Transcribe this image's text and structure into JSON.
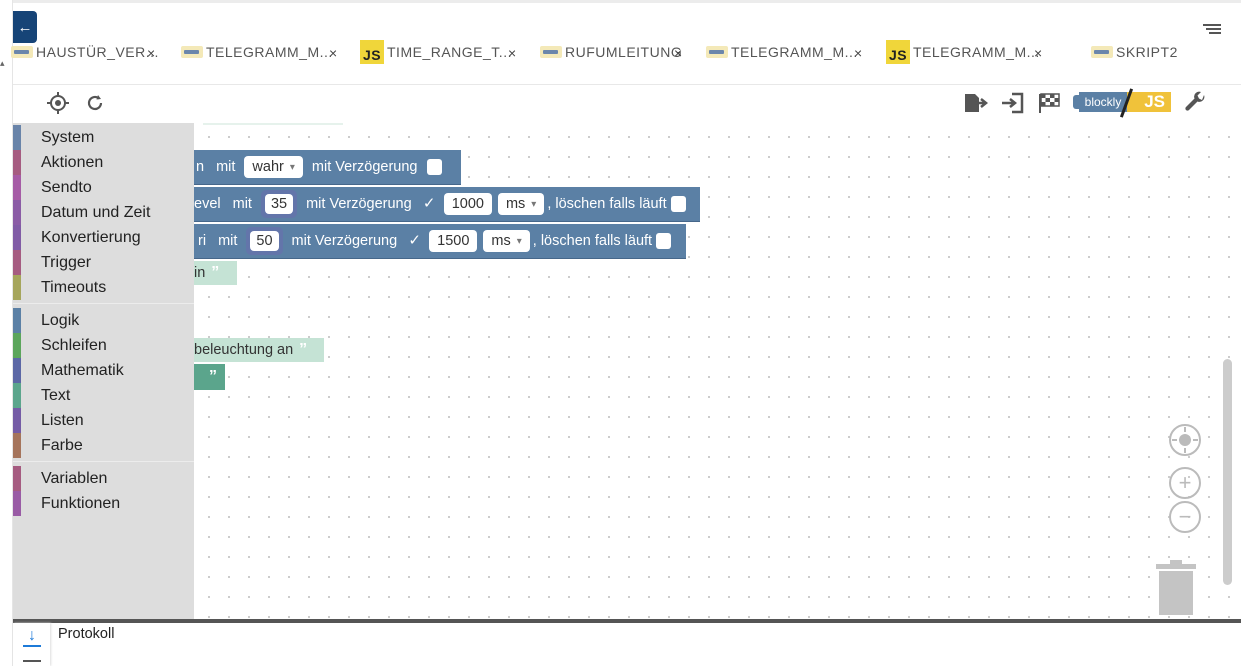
{
  "tabs": [
    {
      "icon": "blockly-icon",
      "label": "HAUSTÜR_VER...",
      "close": "×"
    },
    {
      "icon": "blockly-icon",
      "label": "TELEGRAMM_M...",
      "close": "×"
    },
    {
      "icon": "js-icon",
      "icon_text": "JS",
      "label": "TIME_RANGE_T...",
      "close": "×"
    },
    {
      "icon": "blockly-icon",
      "label": "RUFUMLEITUNG",
      "close": "×"
    },
    {
      "icon": "blockly-icon",
      "label": "TELEGRAMM_M...",
      "close": "×"
    },
    {
      "icon": "js-icon",
      "icon_text": "JS",
      "label": "TELEGRAMM_M...",
      "close": "×"
    },
    {
      "icon": "blockly-icon",
      "label": "SKRIPT2",
      "close": ""
    }
  ],
  "toolbar": {
    "mode_blockly": "blockly",
    "mode_js": "JS"
  },
  "toolbox": {
    "categories": [
      {
        "label": "System",
        "color": "#6984a9"
      },
      {
        "label": "Aktionen",
        "color": "#a55b80"
      },
      {
        "label": "Sendto",
        "color": "#a55ba5"
      },
      {
        "label": "Datum und Zeit",
        "color": "#8a5ba5"
      },
      {
        "label": "Konvertierung",
        "color": "#805ba5"
      },
      {
        "label": "Trigger",
        "color": "#a55b80"
      },
      {
        "label": "Timeouts",
        "color": "#a5a55b"
      },
      {
        "label": "Logik",
        "color": "#5b80a5"
      },
      {
        "label": "Schleifen",
        "color": "#5ba55b"
      },
      {
        "label": "Mathematik",
        "color": "#5b67a5"
      },
      {
        "label": "Text",
        "color": "#5ba58c"
      },
      {
        "label": "Listen",
        "color": "#745ba5"
      },
      {
        "label": "Farbe",
        "color": "#a5745b"
      },
      {
        "label": "Variablen",
        "color": "#a55b80"
      },
      {
        "label": "Funktionen",
        "color": "#995ba5"
      }
    ]
  },
  "blocks": {
    "row1": {
      "prefix": "n",
      "mit": "mit",
      "value": "wahr",
      "delay_label": "mit Verzögerung"
    },
    "row2": {
      "prefix": "evel",
      "mit": "mit",
      "value": "35",
      "delay_label": "mit Verzögerung",
      "check": "✓",
      "delay": "1000",
      "unit": "ms",
      "clear_label": ", löschen falls läuft"
    },
    "row3": {
      "prefix": "ri",
      "mit": "mit",
      "value": "50",
      "delay_label": "mit Verzögerung",
      "check": "✓",
      "delay": "1500",
      "unit": "ms",
      "clear_label": ", löschen falls läuft"
    },
    "text1": {
      "text": "in",
      "quote": "”"
    },
    "text2": {
      "text": "beleuchtung an",
      "quote": "”"
    },
    "text3": {
      "quote": "”"
    }
  },
  "log": {
    "title": "Protokoll"
  }
}
